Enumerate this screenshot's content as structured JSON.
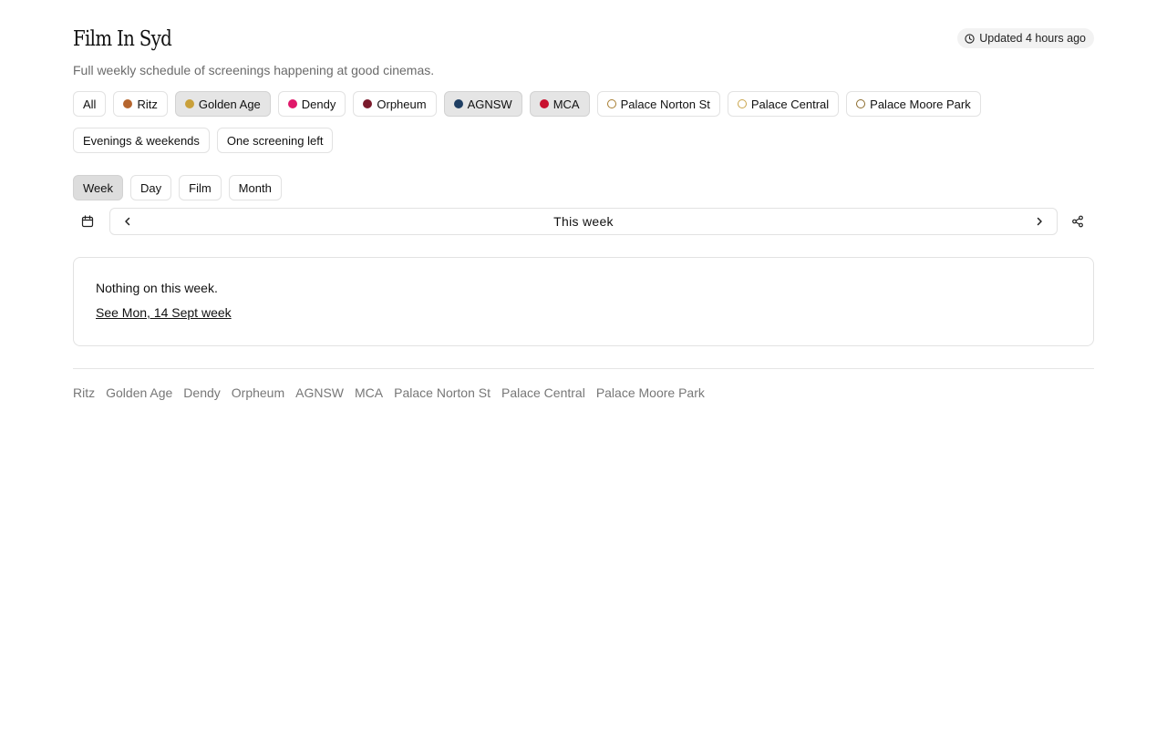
{
  "header": {
    "title": "Film In Syd",
    "subtitle": "Full weekly schedule of screenings happening at good cinemas.",
    "updated": "Updated 4 hours ago",
    "updated_icon": "clock-icon"
  },
  "cinema_filters": [
    {
      "label": "All",
      "active": false
    },
    {
      "label": "Ritz",
      "color": "#b5652e",
      "style": "solid",
      "active": false
    },
    {
      "label": "Golden Age",
      "color": "#c9a03a",
      "style": "solid",
      "active": true
    },
    {
      "label": "Dendy",
      "color": "#e0186a",
      "style": "solid",
      "active": false
    },
    {
      "label": "Orpheum",
      "color": "#7a1a2c",
      "style": "solid",
      "active": false
    },
    {
      "label": "AGNSW",
      "color": "#1f3f63",
      "style": "solid",
      "active": true
    },
    {
      "label": "MCA",
      "color": "#c8102e",
      "style": "solid",
      "active": true
    },
    {
      "label": "Palace Norton St",
      "color": "#a67c2e",
      "style": "ring",
      "active": false
    },
    {
      "label": "Palace Central",
      "color": "#c9a44a",
      "style": "ring",
      "active": false
    },
    {
      "label": "Palace Moore Park",
      "color": "#8a6a2a",
      "style": "ring",
      "active": false
    }
  ],
  "extra_filters": [
    {
      "label": "Evenings & weekends",
      "active": false
    },
    {
      "label": "One screening left",
      "active": false
    }
  ],
  "view_tabs": [
    {
      "label": "Week",
      "active": true
    },
    {
      "label": "Day",
      "active": false
    },
    {
      "label": "Film",
      "active": false
    },
    {
      "label": "Month",
      "active": false
    }
  ],
  "navigator": {
    "label": "This week",
    "calendar_icon": "calendar-icon",
    "prev_icon": "chevron-left-icon",
    "next_icon": "chevron-right-icon",
    "share_icon": "share-icon"
  },
  "empty_state": {
    "message": "Nothing on this week.",
    "link": "See Mon, 14 Sept week"
  },
  "footer": {
    "links": [
      "Ritz",
      "Golden Age",
      "Dendy",
      "Orpheum",
      "AGNSW",
      "MCA",
      "Palace Norton St",
      "Palace Central",
      "Palace Moore Park"
    ]
  }
}
